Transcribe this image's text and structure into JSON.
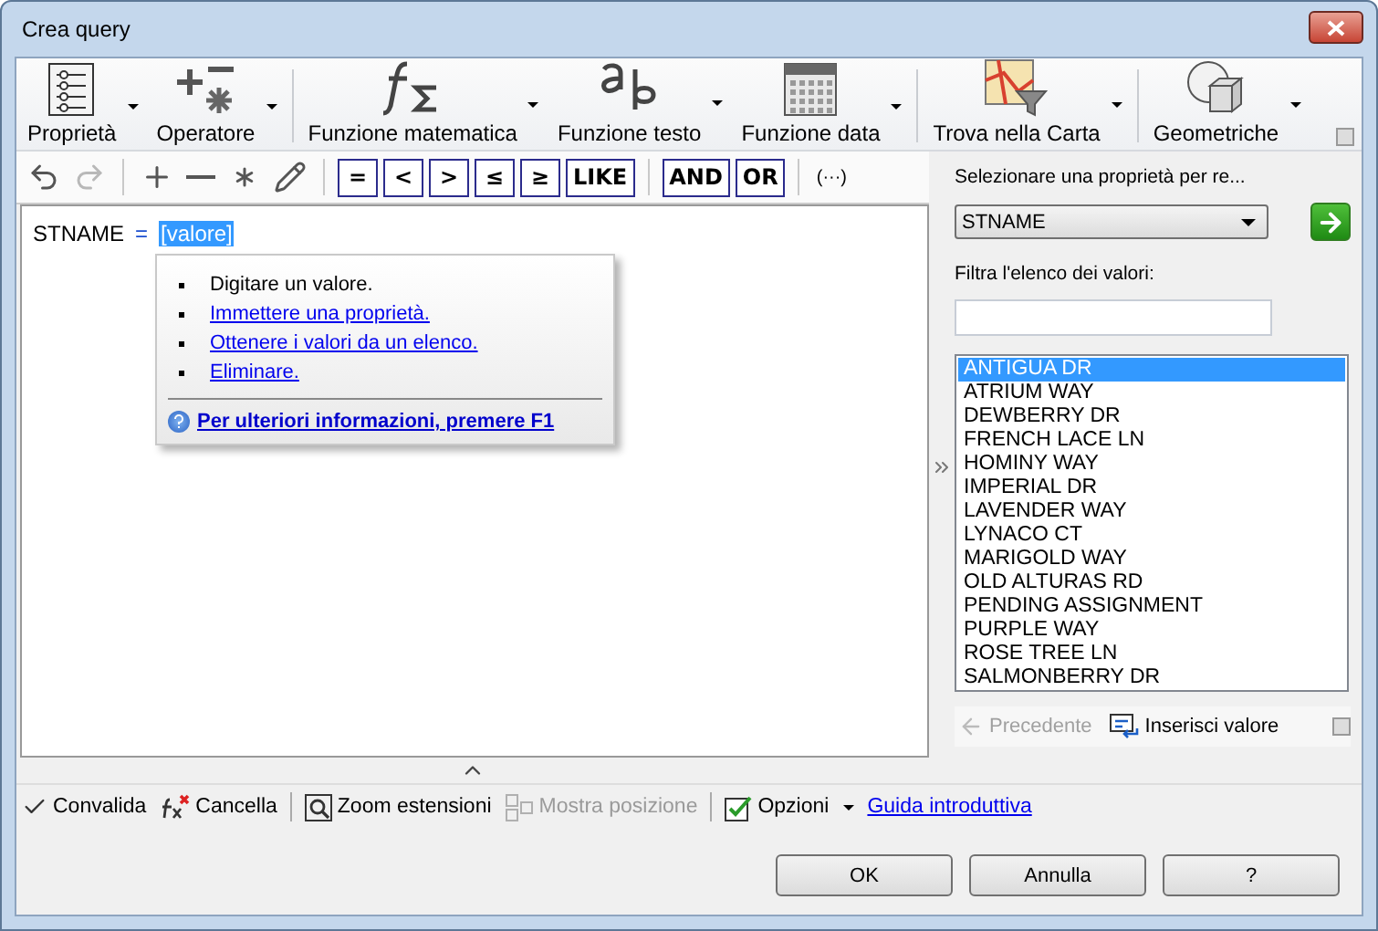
{
  "window": {
    "title": "Crea query"
  },
  "ribbon": {
    "items": [
      {
        "kind": "property",
        "label": "Proprietà"
      },
      {
        "kind": "operator",
        "label": "Operatore"
      },
      {
        "kind": "math",
        "label": "Funzione matematica",
        "separator_before": true
      },
      {
        "kind": "text",
        "label": "Funzione testo"
      },
      {
        "kind": "date",
        "label": "Funzione data"
      },
      {
        "kind": "map",
        "label": "Trova nella Carta",
        "separator_before": true
      },
      {
        "kind": "geometry",
        "label": "Geometriche",
        "separator_before": true
      }
    ]
  },
  "toolbar": {
    "icon_buttons": [
      {
        "kind": "undo",
        "disabled": false
      },
      {
        "kind": "redo",
        "disabled": true
      },
      {
        "kind": "plus",
        "disabled": false
      },
      {
        "kind": "minus",
        "disabled": false
      },
      {
        "kind": "asterisk",
        "disabled": false
      },
      {
        "kind": "pencil",
        "disabled": false
      }
    ],
    "compare_buttons": [
      "=",
      "<",
      ">",
      "≤",
      "≥",
      "LIKE"
    ],
    "logic_buttons": [
      "AND",
      "OR"
    ],
    "group_button": "(···)"
  },
  "editor": {
    "property": "STNAME",
    "operator": "=",
    "value_token": "[valore]",
    "value_selected": true,
    "popup": {
      "items": [
        {
          "kind": "text",
          "text": "Digitare un valore."
        },
        {
          "kind": "link",
          "text": "Immettere una proprietà."
        },
        {
          "kind": "link",
          "text": "Ottenere i valori da un elenco."
        },
        {
          "kind": "link",
          "text": "Eliminare."
        }
      ],
      "help_link": "Per ulteriori informazioni, premere F1"
    }
  },
  "values_panel": {
    "prompt": "Selezionare una proprietà per re...",
    "property": "STNAME",
    "filter_label": "Filtra l'elenco dei valori:",
    "values": [
      {
        "text": "ANTIGUA DR",
        "selected": true
      },
      {
        "text": "ATRIUM WAY",
        "selected": false
      },
      {
        "text": "DEWBERRY DR",
        "selected": false
      },
      {
        "text": "FRENCH LACE LN",
        "selected": false
      },
      {
        "text": "HOMINY WAY",
        "selected": false
      },
      {
        "text": "IMPERIAL DR",
        "selected": false
      },
      {
        "text": "LAVENDER WAY",
        "selected": false
      },
      {
        "text": "LYNACO CT",
        "selected": false
      },
      {
        "text": "MARIGOLD WAY",
        "selected": false
      },
      {
        "text": "OLD ALTURAS RD",
        "selected": false
      },
      {
        "text": "PENDING ASSIGNMENT",
        "selected": false
      },
      {
        "text": "PURPLE WAY",
        "selected": false
      },
      {
        "text": "ROSE TREE LN",
        "selected": false
      },
      {
        "text": "SALMONBERRY DR",
        "selected": false
      }
    ],
    "previous": {
      "label": "Precedente",
      "disabled": true
    },
    "insert": {
      "label": "Inserisci valore",
      "disabled": false
    }
  },
  "bottom_toolbar": {
    "items": [
      {
        "kind": "validate",
        "label": "Convalida",
        "disabled": false
      },
      {
        "kind": "clear",
        "label": "Cancella",
        "disabled": false
      },
      {
        "kind": "zoom",
        "label": "Zoom estensioni",
        "disabled": false,
        "separator_before": true
      },
      {
        "kind": "locate",
        "label": "Mostra posizione",
        "disabled": true
      },
      {
        "kind": "options",
        "label": "Opzioni",
        "disabled": false,
        "separator_before": true
      }
    ],
    "link": "Guida introduttiva"
  },
  "buttons": [
    "OK",
    "Annulla",
    "?"
  ]
}
